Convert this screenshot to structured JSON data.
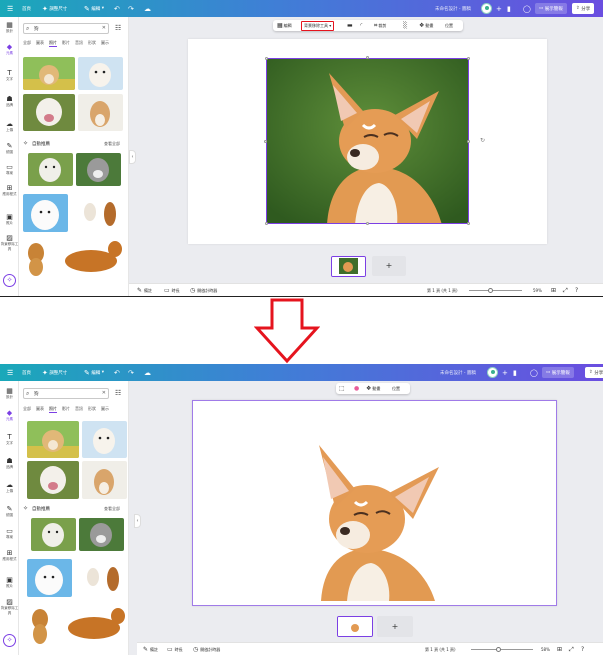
{
  "topbar": {
    "home": "首頁",
    "resize": "調整尺寸",
    "edit": "編輯",
    "title": "未命名設計 - 圖稿",
    "present": "展示簡報",
    "share": "分享"
  },
  "rail": {
    "items": [
      {
        "label": "設計",
        "icon": "▦"
      },
      {
        "label": "元素",
        "icon": "◆"
      },
      {
        "label": "文字",
        "icon": "T"
      },
      {
        "label": "品牌",
        "icon": "☗"
      },
      {
        "label": "上傳",
        "icon": "☁"
      },
      {
        "label": "繪圖",
        "icon": "✎"
      },
      {
        "label": "專案",
        "icon": "▭"
      },
      {
        "label": "應用程式",
        "icon": "⊞"
      },
      {
        "label": "照片",
        "icon": "▣"
      },
      {
        "label": "背景移除工具",
        "icon": "▨"
      }
    ]
  },
  "panel": {
    "search_value": "狗",
    "tabs": [
      "全部",
      "圖表",
      "照片",
      "影片",
      "音訊",
      "形狀",
      "圖示"
    ],
    "section_title": "自動推薦",
    "see_all": "查看全部"
  },
  "toolbar": {
    "items_top": [
      {
        "icon": "▦",
        "label": "編輯"
      },
      {
        "icon": "",
        "label": "背景移除工具"
      },
      {
        "icon": "▬",
        "label": ""
      },
      {
        "icon": "◜",
        "label": ""
      },
      {
        "icon": "⌗",
        "label": "裁剪"
      },
      {
        "icon": "░",
        "label": ""
      },
      {
        "icon": "❖",
        "label": "動畫"
      },
      {
        "icon": "",
        "label": "位置"
      }
    ],
    "items_bottom": [
      {
        "icon": "⬚",
        "label": ""
      },
      {
        "icon": "●",
        "label": ""
      },
      {
        "icon": "❖",
        "label": "動畫"
      },
      {
        "icon": "",
        "label": "位置"
      }
    ]
  },
  "bottombar": {
    "notes": "備註",
    "timer": "時長",
    "draw": "開啟計時器",
    "page_info": "第 1 頁 (共 1 頁)",
    "zoom_top": "59%",
    "zoom_bottom": "58%"
  },
  "add_page": "+",
  "colors": {
    "accent": "#7b3fe4",
    "highlight": "#e5141e",
    "arrow": "#e5141e"
  }
}
